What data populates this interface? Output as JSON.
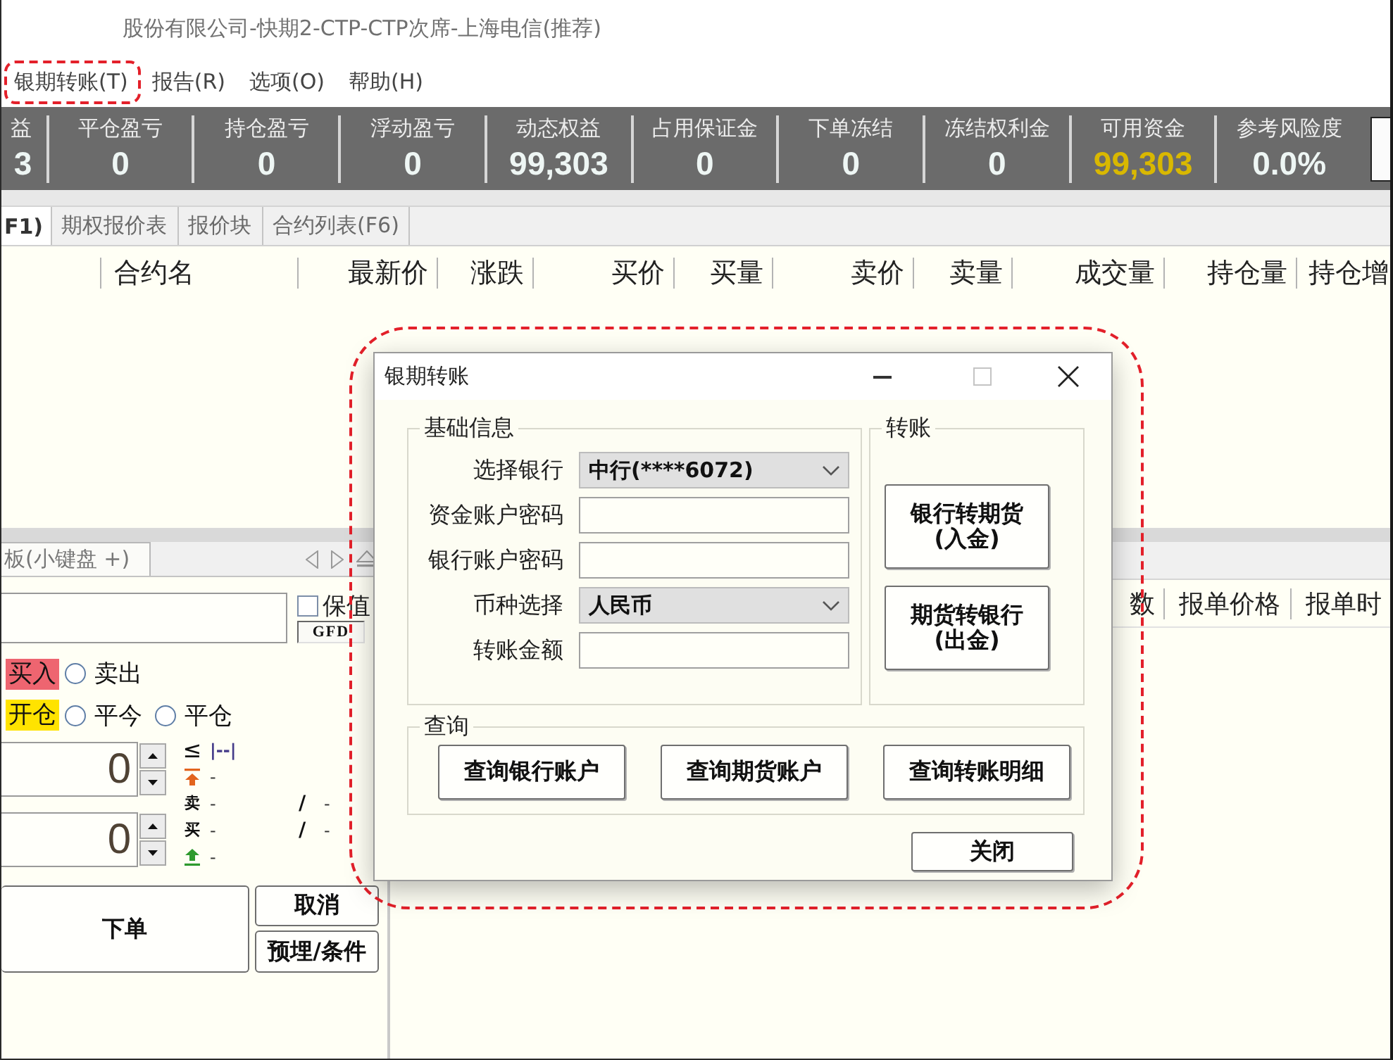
{
  "window": {
    "title": "股份有限公司-快期2-CTP-CTP次席-上海电信(推荐)"
  },
  "menu": [
    {
      "label": "银期转账(T)",
      "highlighted": true
    },
    {
      "label": "报告(R)",
      "highlighted": false
    },
    {
      "label": "选项(O)",
      "highlighted": false
    },
    {
      "label": "帮助(H)",
      "highlighted": false
    }
  ],
  "account_summary": [
    {
      "label": "益",
      "value": "3",
      "accent": false
    },
    {
      "label": "平仓盈亏",
      "value": "0",
      "accent": false
    },
    {
      "label": "持仓盈亏",
      "value": "0",
      "accent": false
    },
    {
      "label": "浮动盈亏",
      "value": "0",
      "accent": false
    },
    {
      "label": "动态权益",
      "value": "99,303",
      "accent": false
    },
    {
      "label": "占用保证金",
      "value": "0",
      "accent": false
    },
    {
      "label": "下单冻结",
      "value": "0",
      "accent": false
    },
    {
      "label": "冻结权利金",
      "value": "0",
      "accent": false
    },
    {
      "label": "可用资金",
      "value": "99,303",
      "accent": true
    },
    {
      "label": "参考风险度",
      "value": "0.0%",
      "accent": false
    }
  ],
  "quote_tabs": [
    {
      "label": "F1)",
      "selected": true
    },
    {
      "label": "期权报价表",
      "selected": false
    },
    {
      "label": "报价块",
      "selected": false
    },
    {
      "label": "合约列表(F6)",
      "selected": false
    }
  ],
  "quote_table": {
    "columns": [
      "合约名",
      "最新价",
      "涨跌",
      "买价",
      "买量",
      "卖价",
      "卖量",
      "成交量",
      "持仓量",
      "持仓增"
    ]
  },
  "order_panel": {
    "tab": {
      "label": "板(小键盘 +)"
    },
    "hedge": {
      "label": "保值",
      "checked": false
    },
    "time_condition": "GFD",
    "direction": [
      {
        "label": "买入",
        "selected": true
      },
      {
        "label": "卖出",
        "selected": false
      }
    ],
    "offset": [
      {
        "label": "开仓",
        "selected": true
      },
      {
        "label": "平今",
        "selected": false
      },
      {
        "label": "平仓",
        "selected": false
      }
    ],
    "quantity": "0",
    "price": "0",
    "price_info": [
      {
        "kind": "limit",
        "symbol": "≤",
        "value": "|--|"
      },
      {
        "kind": "upper_limit",
        "value": "-"
      },
      {
        "kind": "ask",
        "symbol": "卖",
        "value": "-",
        "ratio": "/",
        "ratio_value": "-"
      },
      {
        "kind": "bid",
        "symbol": "买",
        "value": "-",
        "ratio": "/",
        "ratio_value": "-"
      },
      {
        "kind": "lower_limit",
        "value": "-"
      }
    ],
    "buttons": [
      {
        "label": "下单",
        "kind": "submit"
      },
      {
        "label": "取消",
        "kind": "side"
      },
      {
        "label": "预埋/条件",
        "kind": "side"
      }
    ]
  },
  "order_list": {
    "columns": [
      "数",
      "报单价格",
      "报单时"
    ]
  },
  "dialog": {
    "title": "银期转账",
    "highlighted": true,
    "basic_info": {
      "title": "基础信息",
      "fields": [
        {
          "label": "选择银行",
          "kind": "select",
          "value": "中行(****6072)"
        },
        {
          "label": "资金账户密码",
          "kind": "input"
        },
        {
          "label": "银行账户密码",
          "kind": "input"
        },
        {
          "label": "币种选择",
          "kind": "select",
          "value": "人民币"
        },
        {
          "label": "转账金额",
          "kind": "input"
        }
      ]
    },
    "transfer": {
      "title": "转账",
      "buttons": [
        {
          "lines": [
            "银行转期货",
            "(入金)"
          ]
        },
        {
          "lines": [
            "期货转银行",
            "(出金)"
          ]
        }
      ]
    },
    "query": {
      "title": "查询",
      "buttons": [
        "查询银行账户",
        "查询期货账户",
        "查询转账明细"
      ]
    },
    "close_button": "关闭"
  }
}
